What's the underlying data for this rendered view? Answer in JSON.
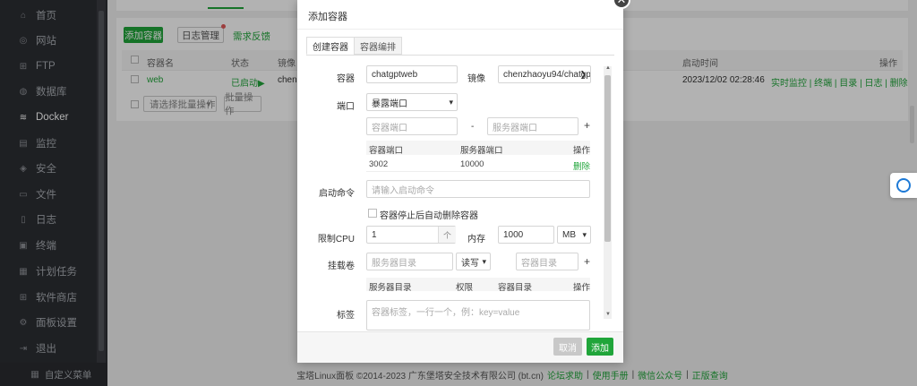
{
  "sidebar": {
    "items": [
      {
        "label": "首页",
        "icon": "home-icon",
        "glyph": "⌂"
      },
      {
        "label": "网站",
        "icon": "globe-icon",
        "glyph": "◎"
      },
      {
        "label": "FTP",
        "icon": "ftp-icon",
        "glyph": "⊞"
      },
      {
        "label": "数据库",
        "icon": "database-icon",
        "glyph": "◍"
      },
      {
        "label": "Docker",
        "icon": "docker-icon",
        "glyph": "≋"
      },
      {
        "label": "监控",
        "icon": "monitor-icon",
        "glyph": "▤"
      },
      {
        "label": "安全",
        "icon": "shield-icon",
        "glyph": "◈"
      },
      {
        "label": "文件",
        "icon": "folder-icon",
        "glyph": "▭"
      },
      {
        "label": "日志",
        "icon": "log-icon",
        "glyph": "▯"
      },
      {
        "label": "终端",
        "icon": "terminal-icon",
        "glyph": "▣"
      },
      {
        "label": "计划任务",
        "icon": "calendar-icon",
        "glyph": "▦"
      },
      {
        "label": "软件商店",
        "icon": "store-icon",
        "glyph": "⊞"
      },
      {
        "label": "面板设置",
        "icon": "gear-icon",
        "glyph": "⚙"
      },
      {
        "label": "退出",
        "icon": "logout-icon",
        "glyph": "⇥"
      }
    ],
    "bottom": "自定义菜单"
  },
  "main": {
    "add_container": "添加容器",
    "log_manage": "日志管理",
    "feedback": "需求反馈",
    "columns": [
      "容器名",
      "状态",
      "镜像",
      "启动时间",
      "操作"
    ],
    "row": {
      "name": "web",
      "status": "已启动▶",
      "image": "chenz",
      "start_time": "2023/12/02 02:28:46",
      "actions": "实时监控 | 终端 | 目录 | 日志 | 删除"
    },
    "batch_select": "请选择批量操作",
    "batch_button": "批量操作"
  },
  "footer": {
    "copyright": "宝塔Linux面板 ©2014-2023 广东堡塔安全技术有限公司 (bt.cn)",
    "links": [
      "论坛求助",
      "使用手册",
      "微信公众号",
      "正版查询"
    ],
    "separator": "|"
  },
  "modal": {
    "title": "添加容器",
    "tabs": [
      "创建容器",
      "容器编排"
    ],
    "container_label": "容器",
    "container_value": "chatgptweb",
    "image_label": "镜像",
    "image_value": "chenzhaoyu94/chatgp",
    "port_label": "端口",
    "port_mode": "暴露端口",
    "container_port_ph": "容器端口",
    "dash": "-",
    "server_port_ph": "服务器端口",
    "port_table_headers": [
      "容器端口",
      "服务器端口",
      "操作"
    ],
    "port_rows": [
      {
        "container": "3002",
        "server": "10000",
        "op": "删除"
      }
    ],
    "cmd_label": "启动命令",
    "cmd_ph": "请输入启动命令",
    "auto_remove": "容器停止后自动删除容器",
    "cpu_label": "限制CPU",
    "cpu_value": "1",
    "mem_label": "内存",
    "mem_value": "1000",
    "mem_unit": "MB",
    "volume_label": "挂载卷",
    "server_dir_ph": "服务器目录",
    "perm_value": "读写",
    "container_dir_ph": "容器目录",
    "volume_headers": [
      "服务器目录",
      "权限",
      "容器目录",
      "操作"
    ],
    "tag_label": "标签",
    "tag_ph": "容器标签，一行一个，例：key=value",
    "cancel": "取消",
    "confirm": "添加"
  },
  "colors": {
    "accent": "#20a53a",
    "sidebar": "#2c2e33",
    "danger": "#e05a5a"
  }
}
